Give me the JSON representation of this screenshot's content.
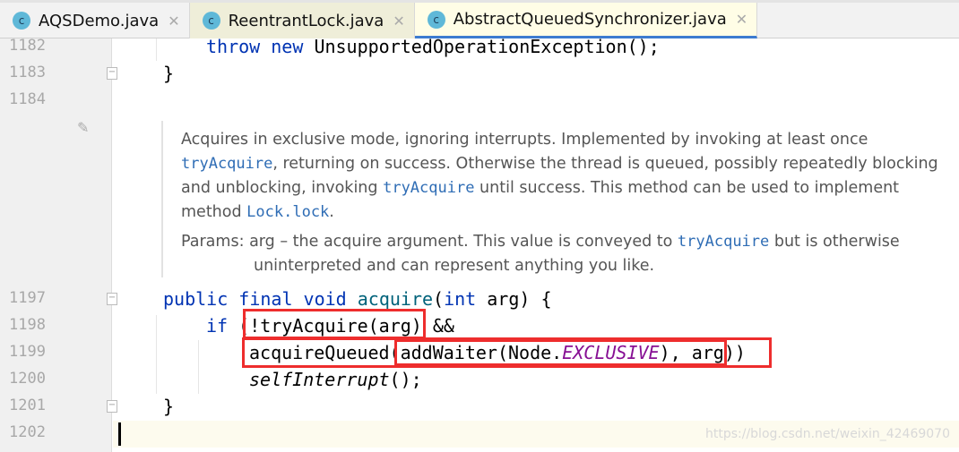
{
  "tabs": [
    {
      "label": "AQSDemo.java",
      "icon": "class-run-icon",
      "closable": true
    },
    {
      "label": "ReentrantLock.java",
      "icon": "class-locked-icon",
      "closable": true
    },
    {
      "label": "AbstractQueuedSynchronizer.java",
      "icon": "class-locked-icon",
      "closable": true,
      "active": true
    }
  ],
  "lines": {
    "l1182": "1182",
    "l1183": "1183",
    "l1184": "1184",
    "l1197": "1197",
    "l1198": "1198",
    "l1199": "1199",
    "l1200": "1200",
    "l1201": "1201",
    "l1202": "1202"
  },
  "code": {
    "c1182": {
      "kw1": "throw",
      "kw2": "new",
      "rest": "UnsupportedOperationException();"
    },
    "c1183": "}",
    "c1197": {
      "kw": "public final void",
      "fn": "acquire",
      "p1": "(",
      "kw2": "int",
      "p2": " arg) {"
    },
    "c1198": {
      "kw": "if",
      "p1": " (",
      "call": "!tryAcquire(arg)",
      "p2": " &&"
    },
    "c1199": {
      "a": "acquireQueued(",
      "b": "addWaiter(Node.",
      "cst": "EXCLUSIVE",
      "c": "), arg",
      "d": "))"
    },
    "c1200": {
      "it": "selfInterrupt",
      "p": "();"
    },
    "c1201": "}"
  },
  "doc": {
    "p1a": "Acquires in exclusive mode, ignoring interrupts. Implemented by invoking at least once",
    "p1b_link": "tryAcquire",
    "p1b": ", returning on success. Otherwise the thread is queued, possibly repeatedly blocking",
    "p1c": "and unblocking, invoking",
    "p1c_link": "tryAcquire",
    "p1c2": "until success. This method can be used to implement",
    "p1d": "method",
    "p1d_link": "Lock.lock",
    "p1d2": ".",
    "params_label": "Params:",
    "params_a": "arg – the acquire argument. This value is conveyed to",
    "params_link": "tryAcquire",
    "params_b": "but is otherwise",
    "params_c": "uninterpreted and can represent anything you like."
  },
  "watermark": "https://blog.csdn.net/weixin_42469070",
  "colors": {
    "highlight_box": "#ee2d2d",
    "keyword": "#0033b3",
    "tab_active_underline": "#3c7bd0"
  }
}
